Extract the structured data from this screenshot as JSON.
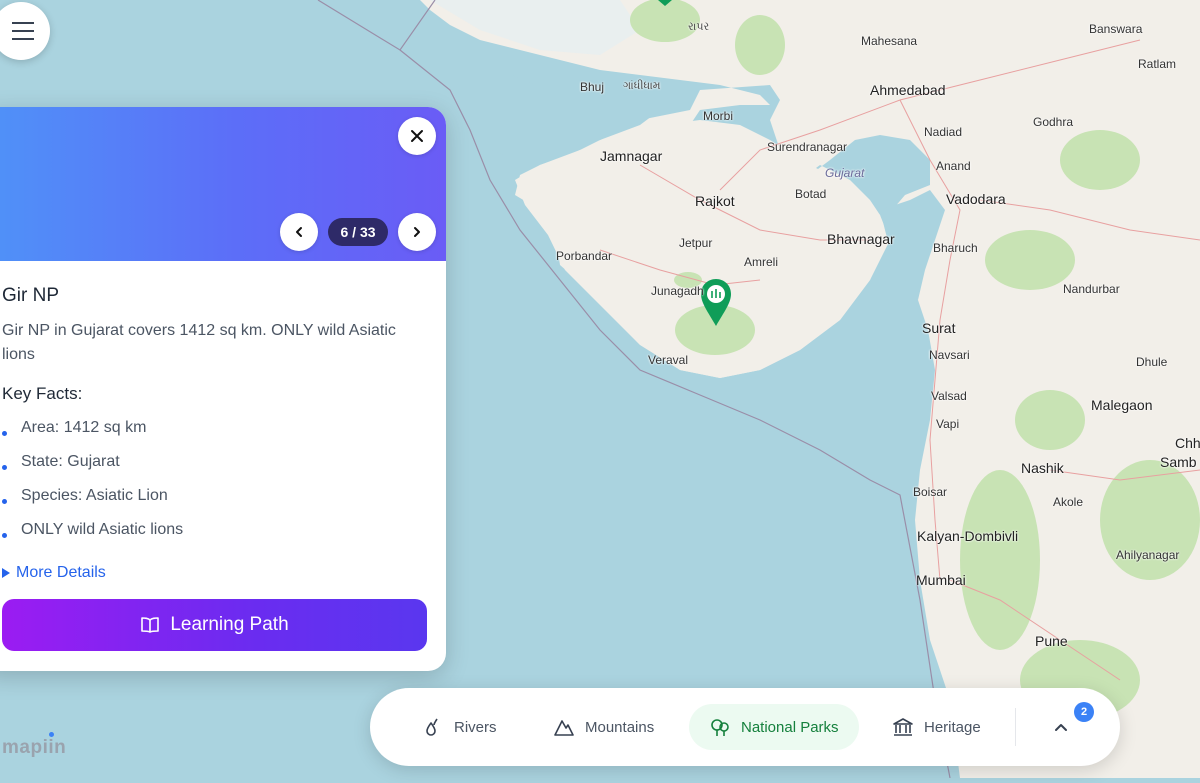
{
  "map": {
    "land_color": "#f2efe9",
    "sea_color": "#aad3df",
    "forest_color": "#c8e3b4",
    "marker_color": "#0f9d58",
    "labels": {
      "raapar": "રાપર",
      "mahesana": "Mahesana",
      "banswara": "Banswara",
      "ratlam": "Ratlam",
      "bhuj": "Bhuj",
      "gandhidham": "ગાંધીધામ",
      "ahmedabad": "Ahmedabad",
      "morbi": "Morbi",
      "nadiad": "Nadiad",
      "godhra": "Godhra",
      "jamnagar": "Jamnagar",
      "surendranagar": "Surendranagar",
      "anand": "Anand",
      "gujarat": "Gujarat",
      "rajkot": "Rajkot",
      "botad": "Botad",
      "vadodara": "Vadodara",
      "jetpur": "Jetpur",
      "bhavnagar": "Bhavnagar",
      "bharuch": "Bharuch",
      "porbandar": "Porbandar",
      "amreli": "Amreli",
      "junagadh": "Junagadh",
      "nandurbar": "Nandurbar",
      "surat": "Surat",
      "navsari": "Navsari",
      "dhule": "Dhule",
      "veraval": "Veraval",
      "valsad": "Valsad",
      "malegaon": "Malegaon",
      "vapi": "Vapi",
      "chh": "Chh",
      "samb": "Samb",
      "nashik": "Nashik",
      "boisar": "Boisar",
      "akole": "Akole",
      "kalyan": "Kalyan-Dombivli",
      "ahilyanagar": "Ahilyanagar",
      "mumbai": "Mumbai",
      "pune": "Pune"
    }
  },
  "menu": {
    "icon": "hamburger-icon"
  },
  "panel": {
    "counter": "6 / 33",
    "title": "Gir NP",
    "description": "Gir NP in Gujarat covers 1412 sq km. ONLY wild Asiatic lions",
    "key_facts_heading": "Key Facts:",
    "key_facts": [
      "Area: 1412 sq km",
      "State: Gujarat",
      "Species: Asiatic Lion",
      "ONLY wild Asiatic lions"
    ],
    "more_details": "More Details",
    "learning_path": "Learning Path",
    "hero_gradient": [
      "#4f93f8",
      "#6a5cf6"
    ],
    "button_gradient": [
      "#9b1cf2",
      "#5a37ef"
    ]
  },
  "brand": "mapiin",
  "toolbar": {
    "items": [
      {
        "label": "Rivers",
        "icon": "droplets-icon",
        "active": false
      },
      {
        "label": "Mountains",
        "icon": "mountain-icon",
        "active": false
      },
      {
        "label": "National Parks",
        "icon": "trees-icon",
        "active": true
      },
      {
        "label": "Heritage",
        "icon": "landmark-icon",
        "active": false
      }
    ],
    "badge_count": "2",
    "expand_icon": "chevron-up-icon"
  }
}
